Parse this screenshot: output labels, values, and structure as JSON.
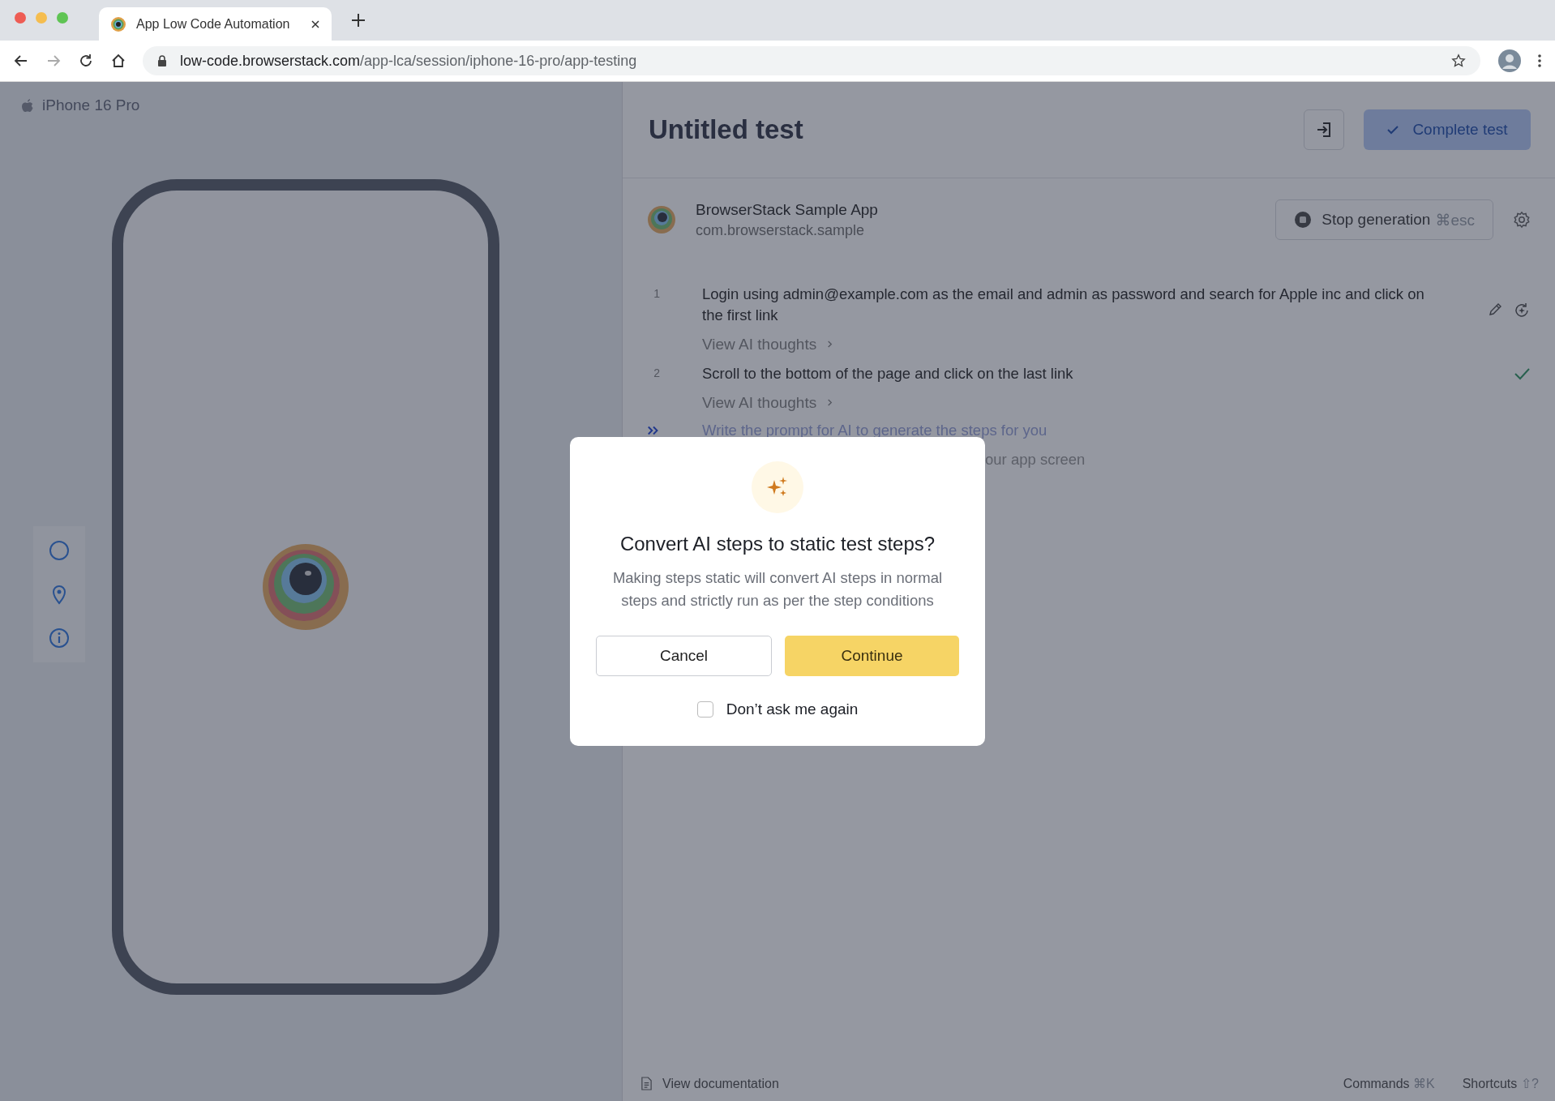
{
  "browser": {
    "tab": {
      "title": "App Low Code Automation",
      "selected": true
    },
    "url": {
      "domain": "low-code.browserstack.com",
      "path": "/app-lca/session/iphone-16-pro/app-testing"
    }
  },
  "device": {
    "name": "iPhone 16 Pro"
  },
  "test": {
    "title": "Untitled test",
    "complete_button": {
      "label": "Complete test",
      "disabled": true
    }
  },
  "app": {
    "name": "BrowserStack Sample App",
    "package": "com.browserstack.sample",
    "stop_button": {
      "label": "Stop generation",
      "shortcut": "⌘esc"
    }
  },
  "steps": [
    {
      "number": "1",
      "text": "Login using admin@example.com as the email and admin as password and search for Apple inc and click on the first link",
      "thoughts_link": "View AI thoughts",
      "passed": false,
      "actions_visible": true
    },
    {
      "number": "2",
      "text": "Scroll to the bottom of the page and click on the last link",
      "thoughts_link": "View AI thoughts",
      "passed": true,
      "actions_visible": false
    }
  ],
  "prompt": {
    "placeholder": "Write the prompt for AI to generate the steps for you",
    "hint": "our app screen"
  },
  "footer": {
    "docs_link": "View documentation",
    "shortcuts": [
      {
        "label": "Commands",
        "key": "⌘K"
      },
      {
        "label": "Shortcuts",
        "key": "⇧?"
      }
    ]
  },
  "dialog": {
    "title": "Convert AI steps to static test steps?",
    "message": "Making steps static will convert AI steps in normal steps and strictly run as per the step conditions",
    "buttons": [
      {
        "label": "Cancel",
        "kind": "secondary"
      },
      {
        "label": "Continue",
        "kind": "primary"
      }
    ],
    "checkbox": {
      "label": "Don’t ask me again",
      "checked": false
    }
  }
}
